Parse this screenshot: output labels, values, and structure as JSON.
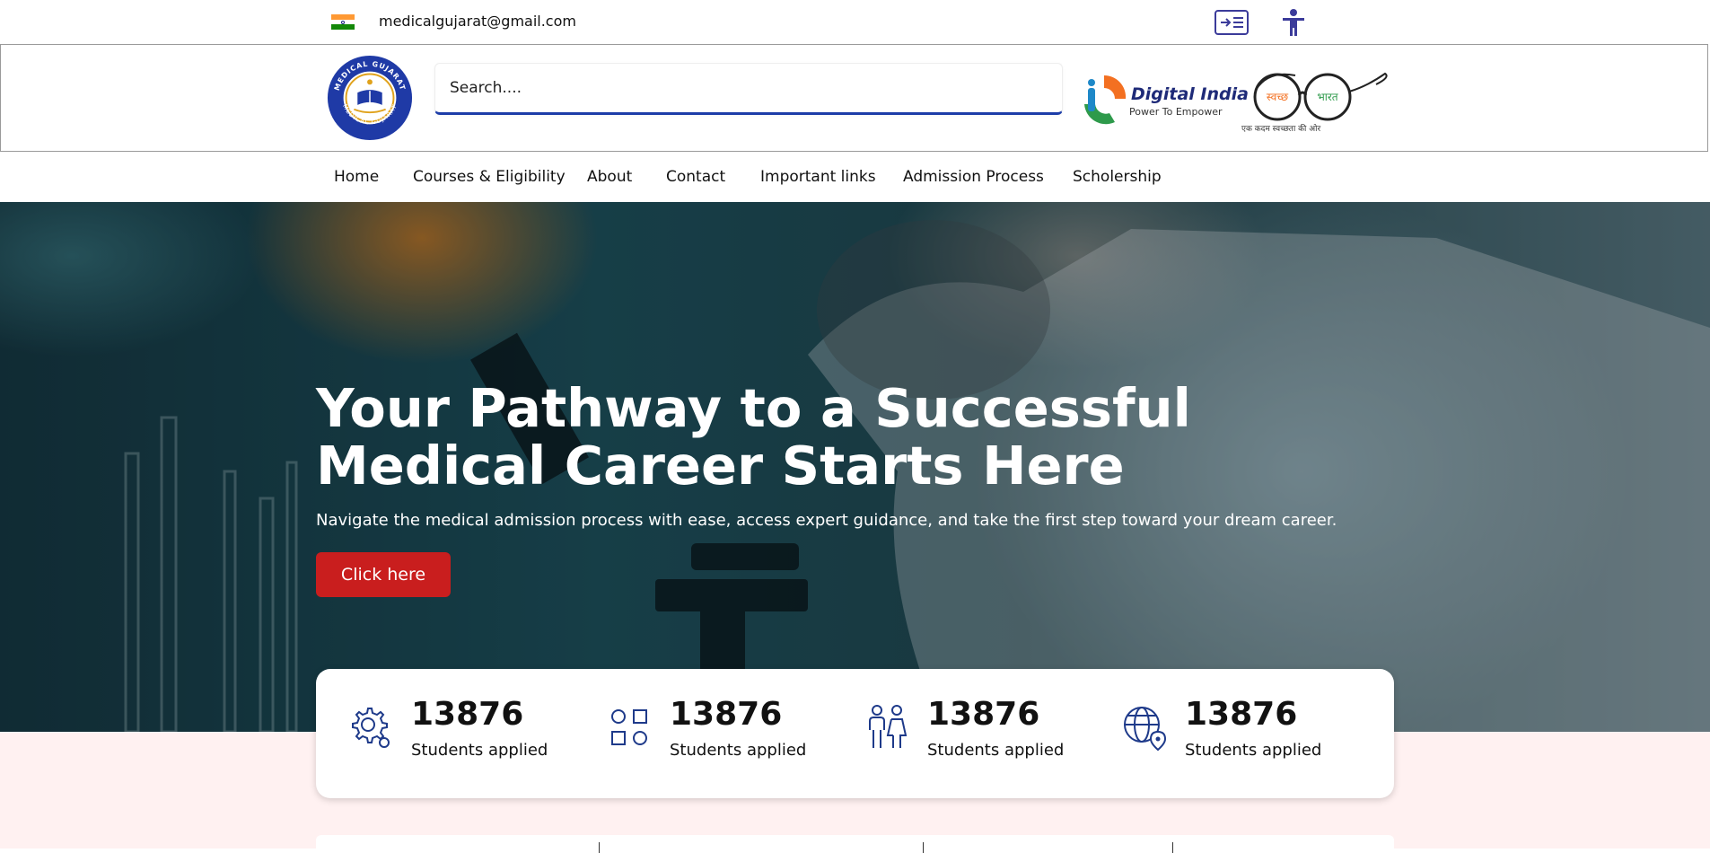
{
  "topbar": {
    "email": "medicalgujarat@gmail.com",
    "flag_colors": [
      "#ff9933",
      "#ffffff",
      "#138808"
    ],
    "icons": [
      "sitemap-icon",
      "accessibility-icon"
    ]
  },
  "header": {
    "logo_ring_text_top": "MEDICAL GUJARAT",
    "logo_ring_text_bottom": "MEDICAL GUJARAT",
    "search_placeholder": "Search....",
    "digital_india_title": "Digital India",
    "digital_india_subtitle": "Power To Empower",
    "swachh_left": "स्वच्छ",
    "swachh_right": "भारत",
    "swachh_tagline": "एक कदम स्वच्छता की ओर"
  },
  "nav": {
    "items": [
      {
        "label": "Home"
      },
      {
        "label": "Courses & Eligibility"
      },
      {
        "label": "About"
      },
      {
        "label": "Contact"
      },
      {
        "label": "Important links"
      },
      {
        "label": "Admission Process"
      },
      {
        "label": "Scholership"
      }
    ]
  },
  "hero": {
    "title": "Your Pathway to a Successful Medical Career Starts Here",
    "subtitle": "Navigate the medical admission process with ease, access expert guidance, and take the first step toward your dream career.",
    "button_label": "Click here"
  },
  "stats": [
    {
      "icon": "gear-icon",
      "value": "13876",
      "label": "Students applied"
    },
    {
      "icon": "shapes-icon",
      "value": "13876",
      "label": "Students applied"
    },
    {
      "icon": "people-icon",
      "value": "13876",
      "label": "Students applied"
    },
    {
      "icon": "globe-pin-icon",
      "value": "13876",
      "label": "Students applied"
    }
  ],
  "colors": {
    "primary_blue": "#1d3da8",
    "accent_red": "#c91e1e",
    "icon_blue": "#1e3a8a",
    "band_pink": "#fff1f1"
  }
}
